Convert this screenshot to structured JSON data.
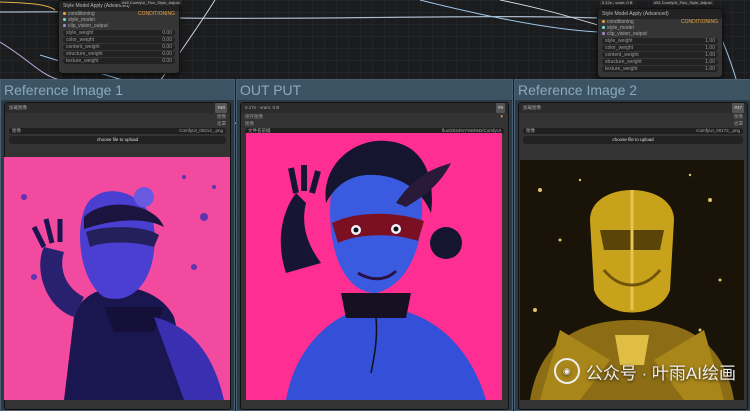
{
  "node_left": {
    "tag": "#48 ComfyUI_Flux_Style_Adjust",
    "title": "Style Model Apply (Advanced)",
    "inputs": [
      "conditioning",
      "style_model",
      "clip_vision_output"
    ],
    "output": "CONDITIONING",
    "widgets": [
      {
        "label": "style_weight",
        "value": "0.00"
      },
      {
        "label": "color_weight",
        "value": "0.00"
      },
      {
        "label": "content_weight",
        "value": "0.00"
      },
      {
        "label": "structure_weight",
        "value": "0.00"
      },
      {
        "label": "texture_weight",
        "value": "0.00"
      }
    ]
  },
  "node_right": {
    "tag": "#51 ComfyUI_Flux_Style_Adjust",
    "timing": "0.12s - vram: 0 B",
    "title": "Style Model Apply (Advanced)",
    "inputs": [
      "conditioning",
      "style_model",
      "clip_vision_output"
    ],
    "output": "CONDITIONING",
    "widgets": [
      {
        "label": "style_weight",
        "value": "1.00"
      },
      {
        "label": "color_weight",
        "value": "1.00"
      },
      {
        "label": "content_weight",
        "value": "1.00"
      },
      {
        "label": "structure_weight",
        "value": "1.00"
      },
      {
        "label": "texture_weight",
        "value": "1.00"
      }
    ]
  },
  "groups": [
    {
      "title": "Reference Image 1",
      "node_badge": "#40",
      "node_label": "加载图像",
      "out_image": "图像",
      "out_mask": "遮罩",
      "select_label": "图像",
      "select_value": "ComfyUI_00214_.png",
      "upload_label": "choose file to upload"
    },
    {
      "title": "OUT PUT",
      "timing": "0.17s - vram: 0 B",
      "node_badge": "#9",
      "node_label": "保存图像",
      "input_label": "图像",
      "prefix_label": "文件名前缀",
      "prefix_value": "flux/2024%Y%M%D/ComfyUI"
    },
    {
      "title": "Reference Image 2",
      "node_badge": "#47",
      "node_label": "加载图像",
      "out_image": "图像",
      "out_mask": "遮罩",
      "select_label": "图像",
      "select_value": "ComfyUI_00172_.png",
      "upload_label": "choose file to upload"
    }
  ],
  "watermark": "公众号 · 叶雨AI绘画",
  "colors": {
    "canvas": "#1b1c1e",
    "group_bg": "#2d3a44",
    "group_title": "#8ca8bd",
    "wire": "#aab8c8",
    "magenta": "#ff2e93",
    "blue": "#2a3bd8",
    "gold": "#c9a21b"
  }
}
